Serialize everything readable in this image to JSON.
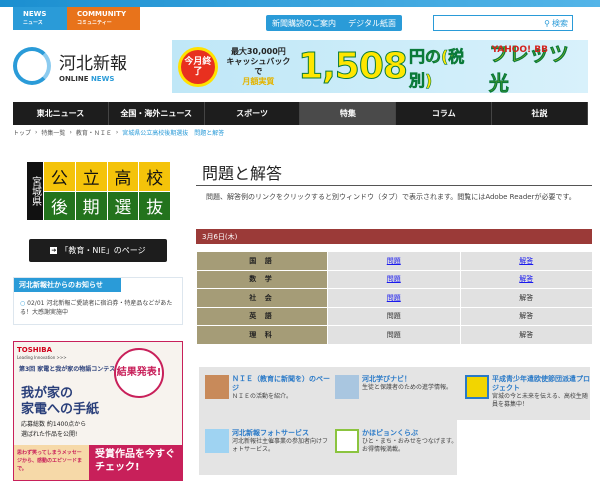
{
  "header": {
    "tabs": [
      {
        "label": "NEWS",
        "sub": "ニュース",
        "color": "#2a9bd8"
      },
      {
        "label": "COMMUNITY",
        "sub": "コミュニティー",
        "color": "#e8731b"
      }
    ],
    "links": [
      "新聞購読のご案内",
      "デジタル紙面"
    ],
    "search": {
      "button": "検索",
      "placeholder": ""
    },
    "logo": {
      "title": "河北新報",
      "sub1": "ONLINE",
      "sub2": "NEWS"
    },
    "banner": {
      "badge": "今月終了",
      "line1": "最大30,000円",
      "line2": "キャッシュバックで",
      "line3": "月額実質",
      "price": "1,508",
      "unit": "円の(税別)",
      "product": "フレッツ光",
      "brand": "YAHOO! BB"
    }
  },
  "nav": [
    {
      "label": "東北ニュース"
    },
    {
      "label": "全国・海外ニュース"
    },
    {
      "label": "スポーツ"
    },
    {
      "label": "特集",
      "active": true
    },
    {
      "label": "コラム"
    },
    {
      "label": "社説"
    }
  ],
  "breadcrumb": [
    "トップ",
    "特集一覧",
    "教育・ＮＩＥ",
    "宮城県公立高校後期選抜　問題と解答"
  ],
  "sidebar": {
    "miyagi": {
      "pref": "宮城県",
      "top": [
        "公",
        "立",
        "高",
        "校"
      ],
      "bottom": [
        "後",
        "期",
        "選",
        "抜"
      ]
    },
    "nie_button": "「教育・NIE」のページ",
    "notice": {
      "title": "河北新報社からのお知らせ",
      "date": "02/01",
      "text": "河北新報ご愛読者に宿泊券・特産品などがあたる！大感謝実施中"
    },
    "ad": {
      "brand": "TOSHIBA",
      "tagline": "Leading Innovation >>>",
      "contest": "第3回 家電と我が家の物語コンテスト",
      "headline1": "我が家の",
      "headline2": "家電への手紙",
      "count": "応募総数 約1400点から",
      "count2": "選ばれた作品を公開!",
      "stamp": "結果発表!",
      "foot_left": "思わず笑ってしまうメッセージから、感動のエピソードまで。",
      "foot_right": "受賞作品を今すぐチェック!"
    }
  },
  "main": {
    "title": "問題と解答",
    "intro_before": "問題、解答例のリンクをクリックすると別ウィンドウ（タブ）で表示されます。閲覧には",
    "intro_link": "Adobe Reader",
    "intro_after": "が必要です。",
    "date": "3月6日(木)",
    "rows": [
      {
        "subject": "国 語",
        "q": "問題",
        "q_link": true,
        "a": "解答",
        "a_link": true
      },
      {
        "subject": "数 学",
        "q": "問題",
        "q_link": true,
        "a": "解答",
        "a_link": true
      },
      {
        "subject": "社 会",
        "q": "問題",
        "q_link": true,
        "a": "解答",
        "a_link": false
      },
      {
        "subject": "英 語",
        "q": "問題",
        "q_link": false,
        "a": "解答",
        "a_link": false
      },
      {
        "subject": "理 科",
        "q": "問題",
        "q_link": false,
        "a": "解答",
        "a_link": false
      }
    ]
  },
  "promos": [
    {
      "title": "ＮＩＥ（教育に新聞を）のページ",
      "desc": "ＮＩＥの活動を紹介。"
    },
    {
      "title": "河北学びナビ！",
      "desc": "生徒と保護者のための進学情報。"
    },
    {
      "title": "平成青少年遣欧使節団派遣プロジェクト",
      "desc": "宮城の今と未来を伝える、高校生随員を募集中！"
    },
    {
      "title": "河北新報フォトサービス",
      "desc": "河北新報社主催事業の参加者向けフォトサービス。"
    },
    {
      "title": "かほピョンくらぶ",
      "desc": "ひと・まち・おみせをつなげます。お得情報満載。"
    }
  ]
}
